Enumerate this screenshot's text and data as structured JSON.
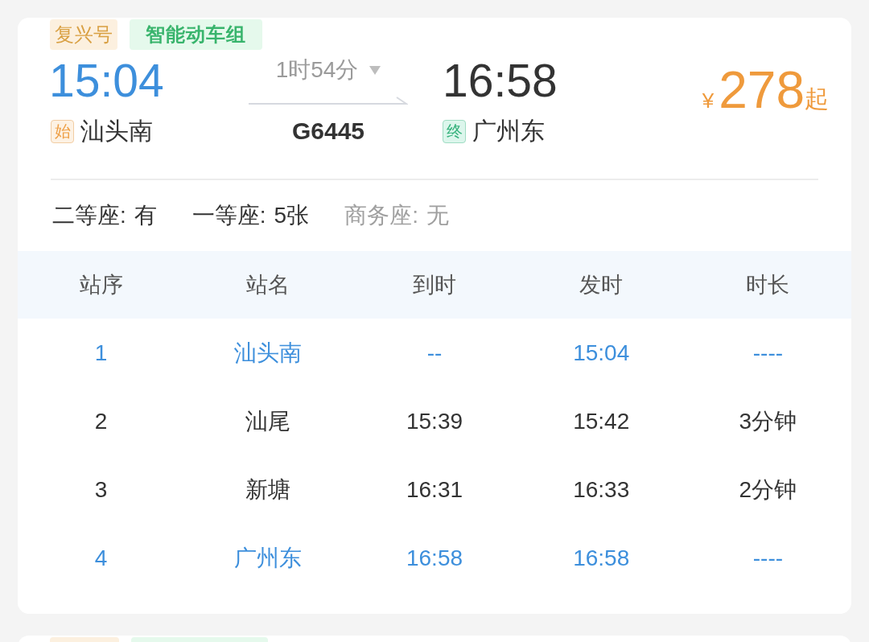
{
  "train": {
    "badges": [
      {
        "text": "复兴号",
        "kind": "brand"
      },
      {
        "text": "智能动车组",
        "kind": "smart"
      }
    ],
    "departure": {
      "time": "15:04",
      "tag": "始",
      "station": "汕头南"
    },
    "duration": "1时54分",
    "train_number": "G6445",
    "arrival": {
      "time": "16:58",
      "tag": "终",
      "station": "广州东"
    },
    "price": {
      "currency": "¥",
      "amount": "278",
      "suffix": "起"
    }
  },
  "seats": [
    {
      "class": "二等座:",
      "availability": "有",
      "available": true
    },
    {
      "class": "一等座:",
      "availability": "5张",
      "available": true
    },
    {
      "class": "商务座:",
      "availability": "无",
      "available": false
    }
  ],
  "stops": {
    "columns": [
      "站序",
      "站名",
      "到时",
      "发时",
      "时长"
    ],
    "rows": [
      {
        "cells": [
          "1",
          "汕头南",
          "--",
          "15:04",
          "----"
        ],
        "endpoint": true
      },
      {
        "cells": [
          "2",
          "汕尾",
          "15:39",
          "15:42",
          "3分钟"
        ],
        "endpoint": false
      },
      {
        "cells": [
          "3",
          "新塘",
          "16:31",
          "16:33",
          "2分钟"
        ],
        "endpoint": false
      },
      {
        "cells": [
          "4",
          "广州东",
          "16:58",
          "16:58",
          "----"
        ],
        "endpoint": true
      }
    ]
  }
}
